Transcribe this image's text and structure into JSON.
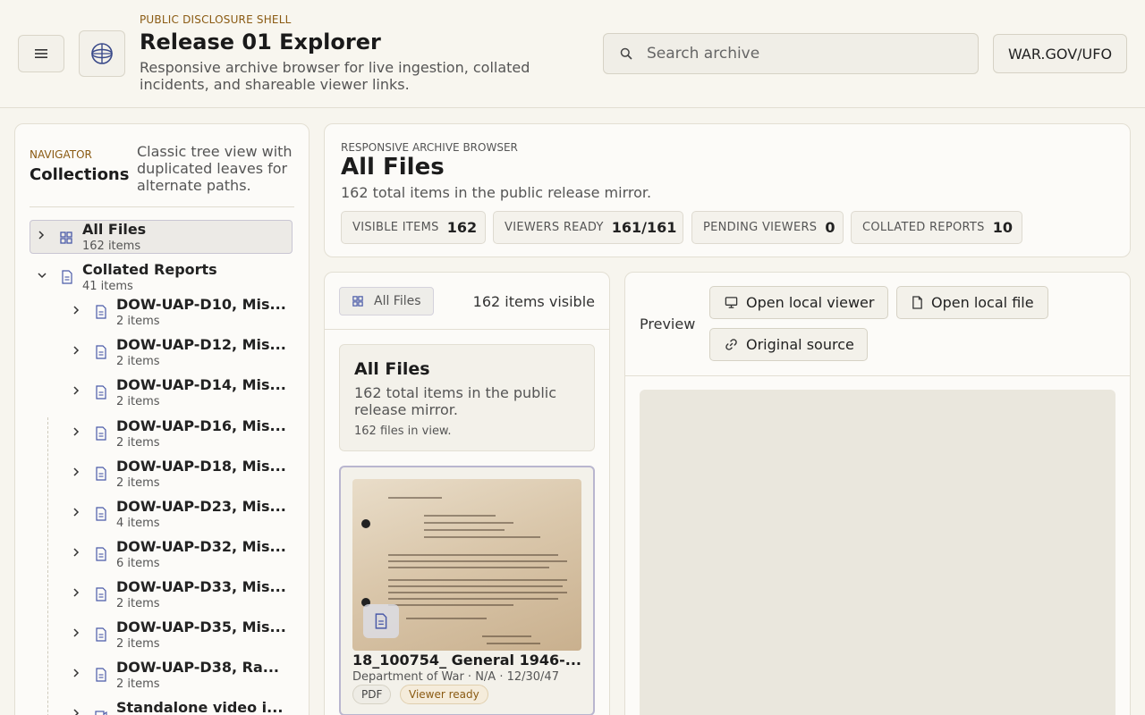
{
  "header": {
    "eyebrow": "PUBLIC DISCLOSURE SHELL",
    "title": "Release 01 Explorer",
    "subtitle": "Responsive archive browser for live ingestion, collated incidents, and shareable viewer links.",
    "search_placeholder": "Search archive",
    "site_label": "WAR.GOV/UFO"
  },
  "sidebar": {
    "eyebrow": "NAVIGATOR",
    "title": "Collections",
    "description": "Classic tree view with duplicated leaves for alternate paths.",
    "items": [
      {
        "title": "All Files",
        "count": "162 items"
      },
      {
        "title": "Collated Reports",
        "count": "41 items"
      },
      {
        "title": "DOW-UAP-D10, Mis...",
        "count": "2 items"
      },
      {
        "title": "DOW-UAP-D12, Mis...",
        "count": "2 items"
      },
      {
        "title": "DOW-UAP-D14, Mis...",
        "count": "2 items"
      },
      {
        "title": "DOW-UAP-D16, Mis...",
        "count": "2 items"
      },
      {
        "title": "DOW-UAP-D18, Mis...",
        "count": "2 items"
      },
      {
        "title": "DOW-UAP-D23, Mis...",
        "count": "4 items"
      },
      {
        "title": "DOW-UAP-D32, Mis...",
        "count": "6 items"
      },
      {
        "title": "DOW-UAP-D33, Mis...",
        "count": "2 items"
      },
      {
        "title": "DOW-UAP-D35, Mis...",
        "count": "2 items"
      },
      {
        "title": "DOW-UAP-D38, Ra...",
        "count": "2 items"
      },
      {
        "title": "Standalone video i..."
      }
    ]
  },
  "main": {
    "eyebrow": "RESPONSIVE ARCHIVE BROWSER",
    "title": "All Files",
    "subtitle": "162 total items in the public release mirror.",
    "stats": [
      {
        "label": "VISIBLE ITEMS",
        "value": "162"
      },
      {
        "label": "VIEWERS READY",
        "value": "161/161"
      },
      {
        "label": "PENDING VIEWERS",
        "value": "0"
      },
      {
        "label": "COLLATED REPORTS",
        "value": "10"
      }
    ]
  },
  "list": {
    "chip_label": "All Files",
    "visible_count": "162 items visible",
    "summary": {
      "title": "All Files",
      "subtitle": "162 total items in the public release mirror.",
      "count": "162 files in view."
    },
    "file": {
      "title": "18_100754_ General 1946-...",
      "meta": "Department of War · N/A · 12/30/47",
      "type_tag": "PDF",
      "status_tag": "Viewer ready"
    }
  },
  "preview": {
    "label": "Preview",
    "open_viewer": "Open local viewer",
    "open_file": "Open local file",
    "original_source": "Original source"
  }
}
